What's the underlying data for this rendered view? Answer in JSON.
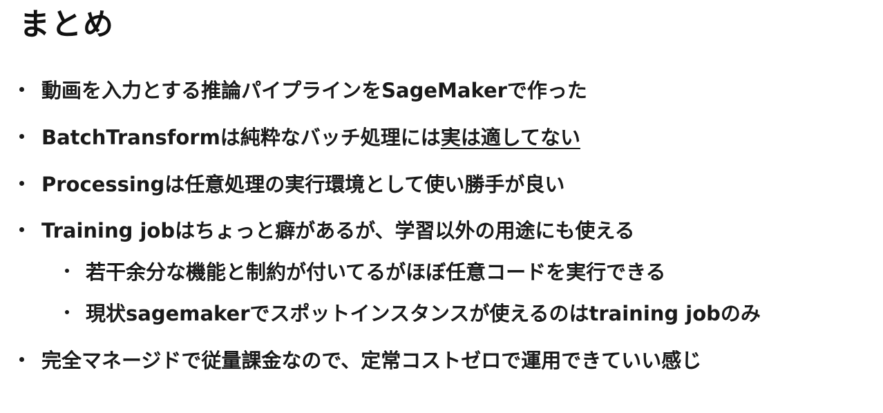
{
  "slide": {
    "title": "まとめ",
    "bullets": [
      {
        "text": "動画を入力とする推論パイプラインをSageMakerで作った"
      },
      {
        "text_plain": "BatchTransformは純粋なバッチ処理には",
        "text_underlined": "実は適してない"
      },
      {
        "text": "Processingは任意処理の実行環境として使い勝手が良い"
      },
      {
        "text": "Training jobはちょっと癖があるが、学習以外の用途にも使える"
      },
      {
        "text": "若干余分な機能と制約が付いてるがほぼ任意コードを実行できる"
      },
      {
        "text": "現状sagemakerでスポットインスタンスが使えるのはtraining jobのみ"
      },
      {
        "text": "完全マネージドで従量課金なので、定常コストゼロで運用できていい感じ"
      }
    ]
  }
}
